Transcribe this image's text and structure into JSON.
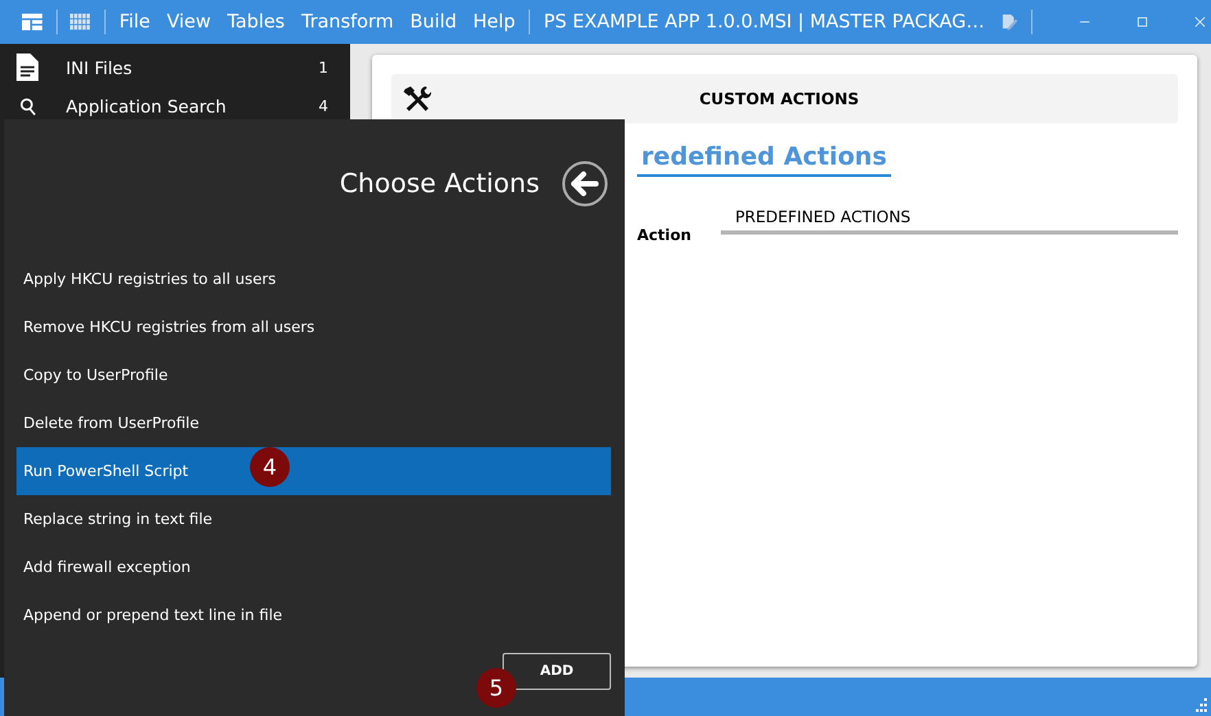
{
  "window": {
    "title": "PS EXAMPLE APP 1.0.0.MSI | MASTER PACKAG…"
  },
  "menu": [
    "File",
    "View",
    "Tables",
    "Transform",
    "Build",
    "Help"
  ],
  "sidebar": {
    "items": [
      {
        "label": "INI Files",
        "count": "1"
      },
      {
        "label": "Application Search",
        "count": "4"
      }
    ]
  },
  "card": {
    "header": "CUSTOM ACTIONS",
    "tab": "redefined Actions",
    "column_label": "Action",
    "column_header": "PREDEFINED ACTIONS"
  },
  "panel": {
    "title": "Choose Actions",
    "actions": [
      {
        "label": "Apply HKCU registries to all users",
        "selected": false
      },
      {
        "label": "Remove HKCU registries from all users",
        "selected": false
      },
      {
        "label": "Copy to UserProfile",
        "selected": false
      },
      {
        "label": "Delete from UserProfile",
        "selected": false
      },
      {
        "label": "Run PowerShell Script",
        "selected": true
      },
      {
        "label": "Replace string in text file",
        "selected": false
      },
      {
        "label": "Add firewall exception",
        "selected": false
      },
      {
        "label": "Append or prepend text line in file",
        "selected": false
      }
    ],
    "add_button": "ADD"
  },
  "callouts": [
    {
      "label": "4"
    },
    {
      "label": "5"
    }
  ]
}
